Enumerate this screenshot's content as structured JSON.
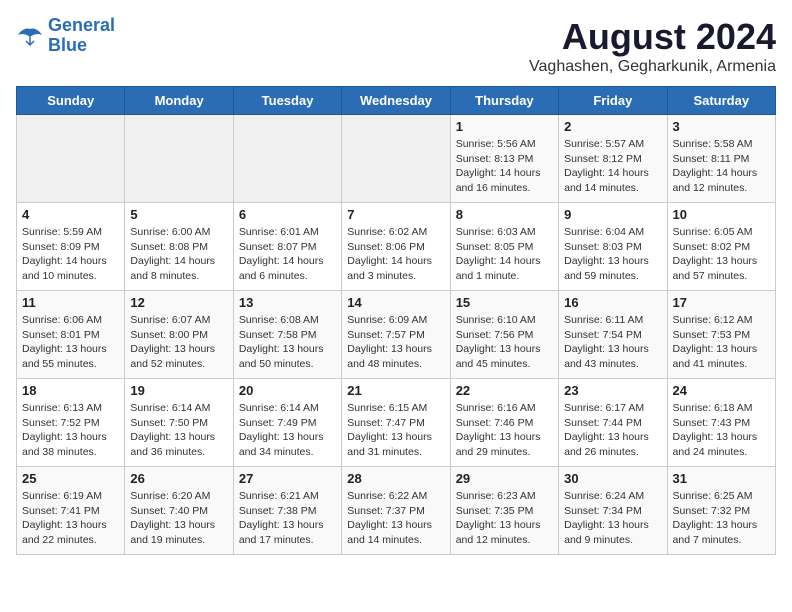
{
  "header": {
    "logo_line1": "General",
    "logo_line2": "Blue",
    "title": "August 2024",
    "subtitle": "Vaghashen, Gegharkunik, Armenia"
  },
  "weekdays": [
    "Sunday",
    "Monday",
    "Tuesday",
    "Wednesday",
    "Thursday",
    "Friday",
    "Saturday"
  ],
  "weeks": [
    [
      {
        "day": "",
        "info": ""
      },
      {
        "day": "",
        "info": ""
      },
      {
        "day": "",
        "info": ""
      },
      {
        "day": "",
        "info": ""
      },
      {
        "day": "1",
        "info": "Sunrise: 5:56 AM\nSunset: 8:13 PM\nDaylight: 14 hours\nand 16 minutes."
      },
      {
        "day": "2",
        "info": "Sunrise: 5:57 AM\nSunset: 8:12 PM\nDaylight: 14 hours\nand 14 minutes."
      },
      {
        "day": "3",
        "info": "Sunrise: 5:58 AM\nSunset: 8:11 PM\nDaylight: 14 hours\nand 12 minutes."
      }
    ],
    [
      {
        "day": "4",
        "info": "Sunrise: 5:59 AM\nSunset: 8:09 PM\nDaylight: 14 hours\nand 10 minutes."
      },
      {
        "day": "5",
        "info": "Sunrise: 6:00 AM\nSunset: 8:08 PM\nDaylight: 14 hours\nand 8 minutes."
      },
      {
        "day": "6",
        "info": "Sunrise: 6:01 AM\nSunset: 8:07 PM\nDaylight: 14 hours\nand 6 minutes."
      },
      {
        "day": "7",
        "info": "Sunrise: 6:02 AM\nSunset: 8:06 PM\nDaylight: 14 hours\nand 3 minutes."
      },
      {
        "day": "8",
        "info": "Sunrise: 6:03 AM\nSunset: 8:05 PM\nDaylight: 14 hours\nand 1 minute."
      },
      {
        "day": "9",
        "info": "Sunrise: 6:04 AM\nSunset: 8:03 PM\nDaylight: 13 hours\nand 59 minutes."
      },
      {
        "day": "10",
        "info": "Sunrise: 6:05 AM\nSunset: 8:02 PM\nDaylight: 13 hours\nand 57 minutes."
      }
    ],
    [
      {
        "day": "11",
        "info": "Sunrise: 6:06 AM\nSunset: 8:01 PM\nDaylight: 13 hours\nand 55 minutes."
      },
      {
        "day": "12",
        "info": "Sunrise: 6:07 AM\nSunset: 8:00 PM\nDaylight: 13 hours\nand 52 minutes."
      },
      {
        "day": "13",
        "info": "Sunrise: 6:08 AM\nSunset: 7:58 PM\nDaylight: 13 hours\nand 50 minutes."
      },
      {
        "day": "14",
        "info": "Sunrise: 6:09 AM\nSunset: 7:57 PM\nDaylight: 13 hours\nand 48 minutes."
      },
      {
        "day": "15",
        "info": "Sunrise: 6:10 AM\nSunset: 7:56 PM\nDaylight: 13 hours\nand 45 minutes."
      },
      {
        "day": "16",
        "info": "Sunrise: 6:11 AM\nSunset: 7:54 PM\nDaylight: 13 hours\nand 43 minutes."
      },
      {
        "day": "17",
        "info": "Sunrise: 6:12 AM\nSunset: 7:53 PM\nDaylight: 13 hours\nand 41 minutes."
      }
    ],
    [
      {
        "day": "18",
        "info": "Sunrise: 6:13 AM\nSunset: 7:52 PM\nDaylight: 13 hours\nand 38 minutes."
      },
      {
        "day": "19",
        "info": "Sunrise: 6:14 AM\nSunset: 7:50 PM\nDaylight: 13 hours\nand 36 minutes."
      },
      {
        "day": "20",
        "info": "Sunrise: 6:14 AM\nSunset: 7:49 PM\nDaylight: 13 hours\nand 34 minutes."
      },
      {
        "day": "21",
        "info": "Sunrise: 6:15 AM\nSunset: 7:47 PM\nDaylight: 13 hours\nand 31 minutes."
      },
      {
        "day": "22",
        "info": "Sunrise: 6:16 AM\nSunset: 7:46 PM\nDaylight: 13 hours\nand 29 minutes."
      },
      {
        "day": "23",
        "info": "Sunrise: 6:17 AM\nSunset: 7:44 PM\nDaylight: 13 hours\nand 26 minutes."
      },
      {
        "day": "24",
        "info": "Sunrise: 6:18 AM\nSunset: 7:43 PM\nDaylight: 13 hours\nand 24 minutes."
      }
    ],
    [
      {
        "day": "25",
        "info": "Sunrise: 6:19 AM\nSunset: 7:41 PM\nDaylight: 13 hours\nand 22 minutes."
      },
      {
        "day": "26",
        "info": "Sunrise: 6:20 AM\nSunset: 7:40 PM\nDaylight: 13 hours\nand 19 minutes."
      },
      {
        "day": "27",
        "info": "Sunrise: 6:21 AM\nSunset: 7:38 PM\nDaylight: 13 hours\nand 17 minutes."
      },
      {
        "day": "28",
        "info": "Sunrise: 6:22 AM\nSunset: 7:37 PM\nDaylight: 13 hours\nand 14 minutes."
      },
      {
        "day": "29",
        "info": "Sunrise: 6:23 AM\nSunset: 7:35 PM\nDaylight: 13 hours\nand 12 minutes."
      },
      {
        "day": "30",
        "info": "Sunrise: 6:24 AM\nSunset: 7:34 PM\nDaylight: 13 hours\nand 9 minutes."
      },
      {
        "day": "31",
        "info": "Sunrise: 6:25 AM\nSunset: 7:32 PM\nDaylight: 13 hours\nand 7 minutes."
      }
    ]
  ]
}
